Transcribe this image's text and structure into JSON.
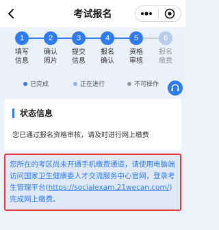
{
  "header": {
    "title": "考试报名"
  },
  "steps": [
    {
      "number": "1",
      "label_line1": "填写",
      "label_line2": "信息",
      "state": "done"
    },
    {
      "number": "2",
      "label_line1": "确认",
      "label_line2": "照片",
      "state": "done"
    },
    {
      "number": "3",
      "label_line1": "提交",
      "label_line2": "信息",
      "state": "done"
    },
    {
      "number": "4",
      "label_line1": "报名",
      "label_line2": "确认",
      "state": "done"
    },
    {
      "number": "5",
      "label_line1": "资格",
      "label_line2": "审核",
      "state": "done"
    },
    {
      "number": "6",
      "label_line1": "报名",
      "label_line2": "缴费",
      "state": "inactive"
    }
  ],
  "legend": {
    "done": "已完成",
    "in_progress": "正在进行",
    "disabled": "不可操作"
  },
  "status": {
    "title": "状态信息",
    "text": "您已通过报名资格审核，请及时进行网上缴费"
  },
  "notice": {
    "text_before": "您所在的考区尚未开通手机缴费通道，请使用电脑端访问国家卫生健康委人才交流服务中心官网，登录考生管理平台(",
    "link": "https://socialexam.21wecan.com/",
    "text_after": ")完成网上缴费。"
  },
  "colors": {
    "accent": "#2e7bf2",
    "done_dot": "#2e7bf2",
    "in_progress_dot": "#8ab4f0",
    "disabled_dot": "#9a9a9a",
    "notice_border": "#e8343a",
    "page_bg": "#eef3f9"
  }
}
